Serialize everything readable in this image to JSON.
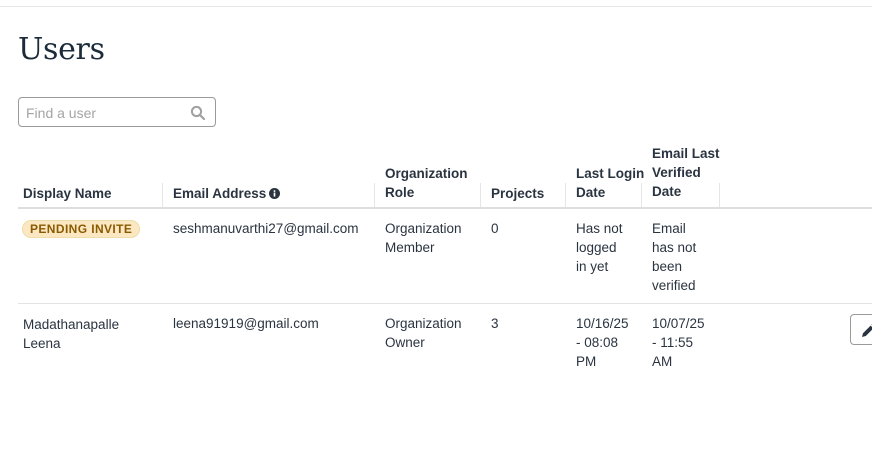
{
  "page": {
    "title": "Users"
  },
  "search": {
    "placeholder": "Find a user"
  },
  "table": {
    "headers": {
      "display_name": "Display Name",
      "email": "Email Address",
      "role_line1": "Organization",
      "role_line2": "Role",
      "projects": "Projects",
      "login_line1": "Last Login",
      "login_line2": "Date",
      "verified_line1": "Email Last",
      "verified_line2": "Verified",
      "verified_line3": "Date"
    },
    "rows": [
      {
        "badge": "PENDING INVITE",
        "email": "seshmanuvarthi27@gmail.com",
        "role_line1": "Organization",
        "role_line2": "Member",
        "projects": "0",
        "login_line1": "Has not",
        "login_line2": "logged",
        "login_line3": "in yet",
        "verified_line1": "Email",
        "verified_line2": "has not",
        "verified_line3": "been",
        "verified_line4": "verified"
      },
      {
        "name_line1": "Madathanapalle",
        "name_line2": "Leena",
        "email": "leena91919@gmail.com",
        "role_line1": "Organization",
        "role_line2": "Owner",
        "projects": "3",
        "login_line1": "10/16/25",
        "login_line2": "- 08:08",
        "login_line3": "PM",
        "verified_line1": "10/07/25",
        "verified_line2": "- 11:55",
        "verified_line3": "AM"
      }
    ]
  },
  "icons": {
    "search": "search-icon",
    "info": "info-icon",
    "edit": "pencil-icon"
  },
  "colors": {
    "badge_bg": "#fbe8c2",
    "badge_text": "#8a5a00",
    "text": "#2a3440"
  }
}
